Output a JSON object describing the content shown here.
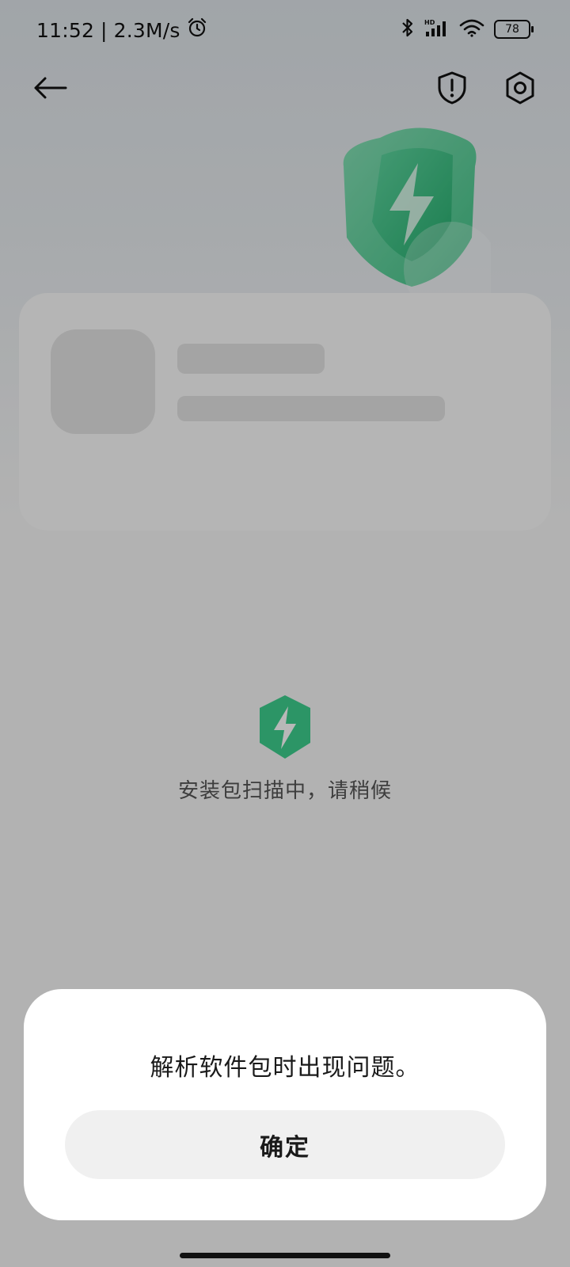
{
  "status_bar": {
    "time": "11:52",
    "separator": "|",
    "network_speed": "2.3M/s",
    "battery_level": "78",
    "icons": [
      "alarm-icon",
      "bluetooth-icon",
      "hd-signal-icon",
      "wifi-icon",
      "battery-icon"
    ]
  },
  "nav": {
    "icons": [
      "back-arrow-icon",
      "shield-alert-icon",
      "settings-icon"
    ]
  },
  "colors": {
    "accent_green": "#3ecf8e",
    "dialog_bg": "#ffffff",
    "button_bg": "#f0f0f0"
  },
  "scan": {
    "status_text": "安装包扫描中，请稍候"
  },
  "dialog": {
    "message": "解析软件包时出现问题。",
    "confirm_label": "确定"
  }
}
